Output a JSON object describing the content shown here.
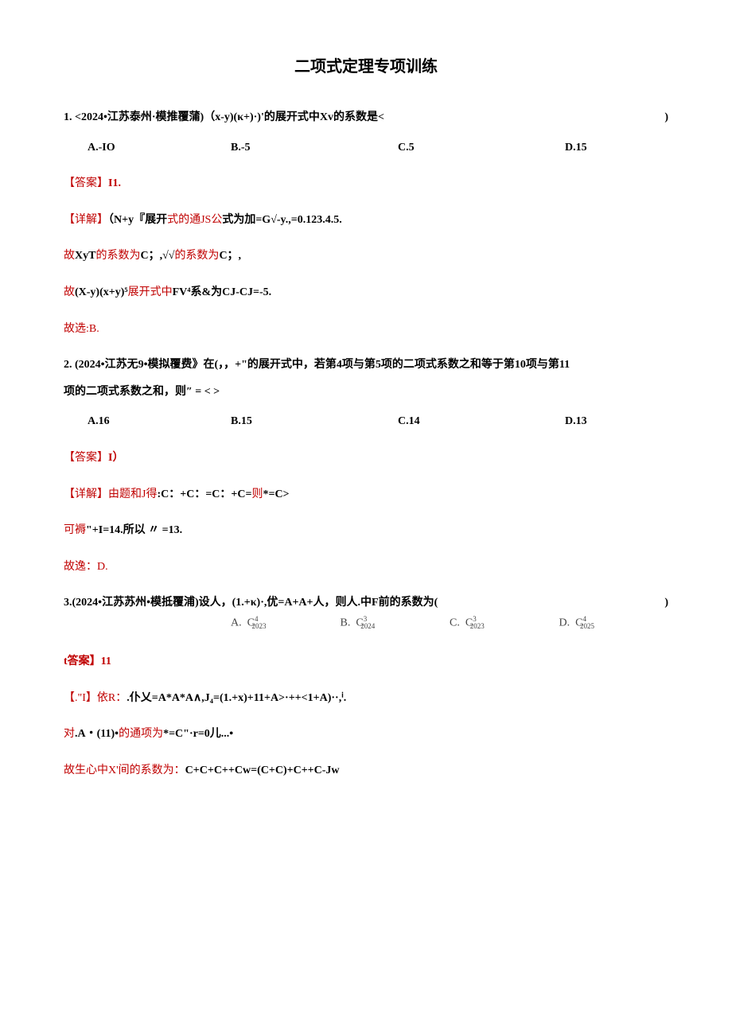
{
  "title": "二项式定理专项训练",
  "q1": {
    "text": "1.   <2024•江苏泰州·模推覆蒲)（x-y)(κ+)·)'的展开式中Xv的系数是<",
    "paren": ")",
    "optA": "A.-IO",
    "optB": "B.-5",
    "optC": "C.5",
    "optD": "D.15"
  },
  "a1": {
    "ans_label": "【答案】",
    "ans_val": "I1.",
    "detail_label": "【详解】",
    "detail_text": "（N+y『展开",
    "detail_red1": "式的通JS公",
    "detail_text2": "式为加=G√-y.,=0.123.4.5.",
    "line3_red": "故",
    "line3_text": "XyT",
    "line3_red2": "的系数为",
    "line3_text2": "C；,√√",
    "line3_red3": "的系数为",
    "line3_text3": "C；,",
    "line4_red": "故",
    "line4_text": "(X-y)(x+y)⁵",
    "line4_red2": "展开式中",
    "line4_text2": "FV⁴系&为CJ-CJ=-5.",
    "line5": "故选:B."
  },
  "q2": {
    "line1": "2.   (2024•江苏无9•模拟覆费》在(，，+\"的展开式中，若第4项与第5项的二项式系数之和等于第10项与第11",
    "line2": "项的二项式系数之和，则″ = <                     >",
    "optA": "A.16",
    "optB": "B.15",
    "optC": "C.14",
    "optD": "D.13"
  },
  "a2": {
    "ans_label": "【答案】",
    "ans_val": "I）",
    "detail_label": "【详解】",
    "detail_red1": "由题和J得",
    "detail_text": ":C：+C：=C：+C=",
    "detail_red2": "则",
    "detail_text2": "*=C>",
    "line3_red": "可褥",
    "line3_text": "\"+I=14.所以 〃 =13.",
    "line4": "故逸：D."
  },
  "q3": {
    "line1_a": "3.(2024•江苏苏州•模抵覆浦)设人，(1.+κ)·,优=A+A+人，则人.中F前的系数为(",
    "line1_b": ")",
    "fA_label": "A.",
    "fA_val": "C",
    "fA_sup": "4",
    "fA_sub": "2023",
    "fB_label": "B.",
    "fB_val": "C",
    "fB_sup": "3",
    "fB_sub": "2024",
    "fC_label": "C.",
    "fC_val": "C",
    "fC_sup": "3",
    "fC_sub": "2023",
    "fD_label": "D.",
    "fD_val": "C",
    "fD_sup": "4",
    "fD_sub": "2025"
  },
  "a3": {
    "ans_label": "t答案】",
    "ans_val": "11",
    "detail_label": "【.\"I】",
    "detail_red1": "依R：",
    "detail_text": ".仆乂=A*A*A∧,J₄=(1.+x)+11+A>·++<1+A)··,ⁱ.",
    "line3_red": "对",
    "line3_text": ".A・(11)•",
    "line3_red2": "的通项为",
    "line3_text2": "*=C\"·r=0儿...•",
    "line4_red": "故生心中X'",
    "line4_red2": "间的系数为：",
    "line4_text": "C+C+C++Cw=(C+C)+C++C-Jw"
  }
}
